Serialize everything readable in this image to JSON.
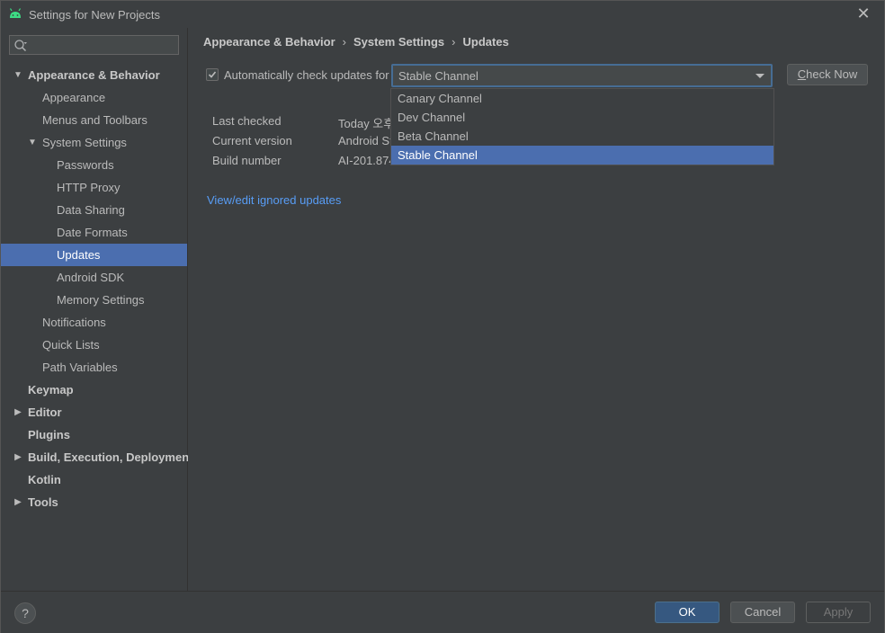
{
  "window": {
    "title": "Settings for New Projects",
    "close_glyph": "✕"
  },
  "search": {
    "value": "",
    "placeholder": ""
  },
  "tree": [
    {
      "label": "Appearance & Behavior",
      "level": 0,
      "bold": true,
      "arrow": "▼",
      "selected": false
    },
    {
      "label": "Appearance",
      "level": 1,
      "bold": false,
      "arrow": "",
      "selected": false
    },
    {
      "label": "Menus and Toolbars",
      "level": 1,
      "bold": false,
      "arrow": "",
      "selected": false
    },
    {
      "label": "System Settings",
      "level": 1,
      "bold": false,
      "arrow": "▼",
      "selected": false
    },
    {
      "label": "Passwords",
      "level": 2,
      "bold": false,
      "arrow": "",
      "selected": false
    },
    {
      "label": "HTTP Proxy",
      "level": 2,
      "bold": false,
      "arrow": "",
      "selected": false
    },
    {
      "label": "Data Sharing",
      "level": 2,
      "bold": false,
      "arrow": "",
      "selected": false
    },
    {
      "label": "Date Formats",
      "level": 2,
      "bold": false,
      "arrow": "",
      "selected": false
    },
    {
      "label": "Updates",
      "level": 2,
      "bold": false,
      "arrow": "",
      "selected": true
    },
    {
      "label": "Android SDK",
      "level": 2,
      "bold": false,
      "arrow": "",
      "selected": false
    },
    {
      "label": "Memory Settings",
      "level": 2,
      "bold": false,
      "arrow": "",
      "selected": false
    },
    {
      "label": "Notifications",
      "level": 1,
      "bold": false,
      "arrow": "",
      "selected": false
    },
    {
      "label": "Quick Lists",
      "level": 1,
      "bold": false,
      "arrow": "",
      "selected": false
    },
    {
      "label": "Path Variables",
      "level": 1,
      "bold": false,
      "arrow": "",
      "selected": false
    },
    {
      "label": "Keymap",
      "level": 0,
      "bold": true,
      "arrow": "",
      "selected": false
    },
    {
      "label": "Editor",
      "level": 0,
      "bold": true,
      "arrow": "▶",
      "selected": false
    },
    {
      "label": "Plugins",
      "level": 0,
      "bold": true,
      "arrow": "",
      "selected": false
    },
    {
      "label": "Build, Execution, Deployment",
      "level": 0,
      "bold": true,
      "arrow": "▶",
      "selected": false
    },
    {
      "label": "Kotlin",
      "level": 0,
      "bold": true,
      "arrow": "",
      "selected": false
    },
    {
      "label": "Tools",
      "level": 0,
      "bold": true,
      "arrow": "▶",
      "selected": false
    }
  ],
  "breadcrumb": {
    "items": [
      "Appearance & Behavior",
      "System Settings",
      "Updates"
    ],
    "separator": "›"
  },
  "updates": {
    "auto_check_label": "Automatically check updates for",
    "auto_check_checked": true,
    "channel_selected": "Stable Channel",
    "check_now_label_underlined": "C",
    "check_now_label_rest": "heck Now",
    "channel_options": [
      "Canary Channel",
      "Dev Channel",
      "Beta Channel",
      "Stable Channel"
    ],
    "info": [
      {
        "label": "Last checked",
        "value": "Today 오후"
      },
      {
        "label": "Current version",
        "value": "Android St"
      },
      {
        "label": "Build number",
        "value": "AI-201.874"
      }
    ],
    "ignored_link": "View/edit ignored updates"
  },
  "footer": {
    "help": "?",
    "ok": "OK",
    "cancel": "Cancel",
    "apply": "Apply"
  },
  "colors": {
    "accent": "#4b6eaf",
    "link": "#589df6",
    "background": "#3c3f41",
    "android_green": "#3ddc84"
  }
}
